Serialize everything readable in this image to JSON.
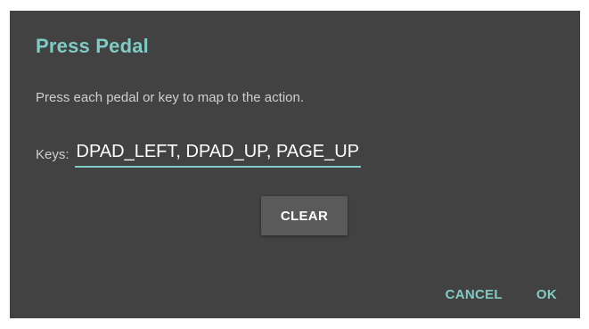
{
  "dialog": {
    "title": "Press Pedal",
    "message": "Press each pedal or key to map to the action.",
    "keys_label": "Keys:",
    "keys_value": "DPAD_LEFT, DPAD_UP, PAGE_UP",
    "clear_label": "CLEAR",
    "cancel_label": "CANCEL",
    "ok_label": "OK"
  },
  "colors": {
    "dialog_background": "#424242",
    "accent": "#80cbc4",
    "button_background": "#5a5a5a"
  }
}
